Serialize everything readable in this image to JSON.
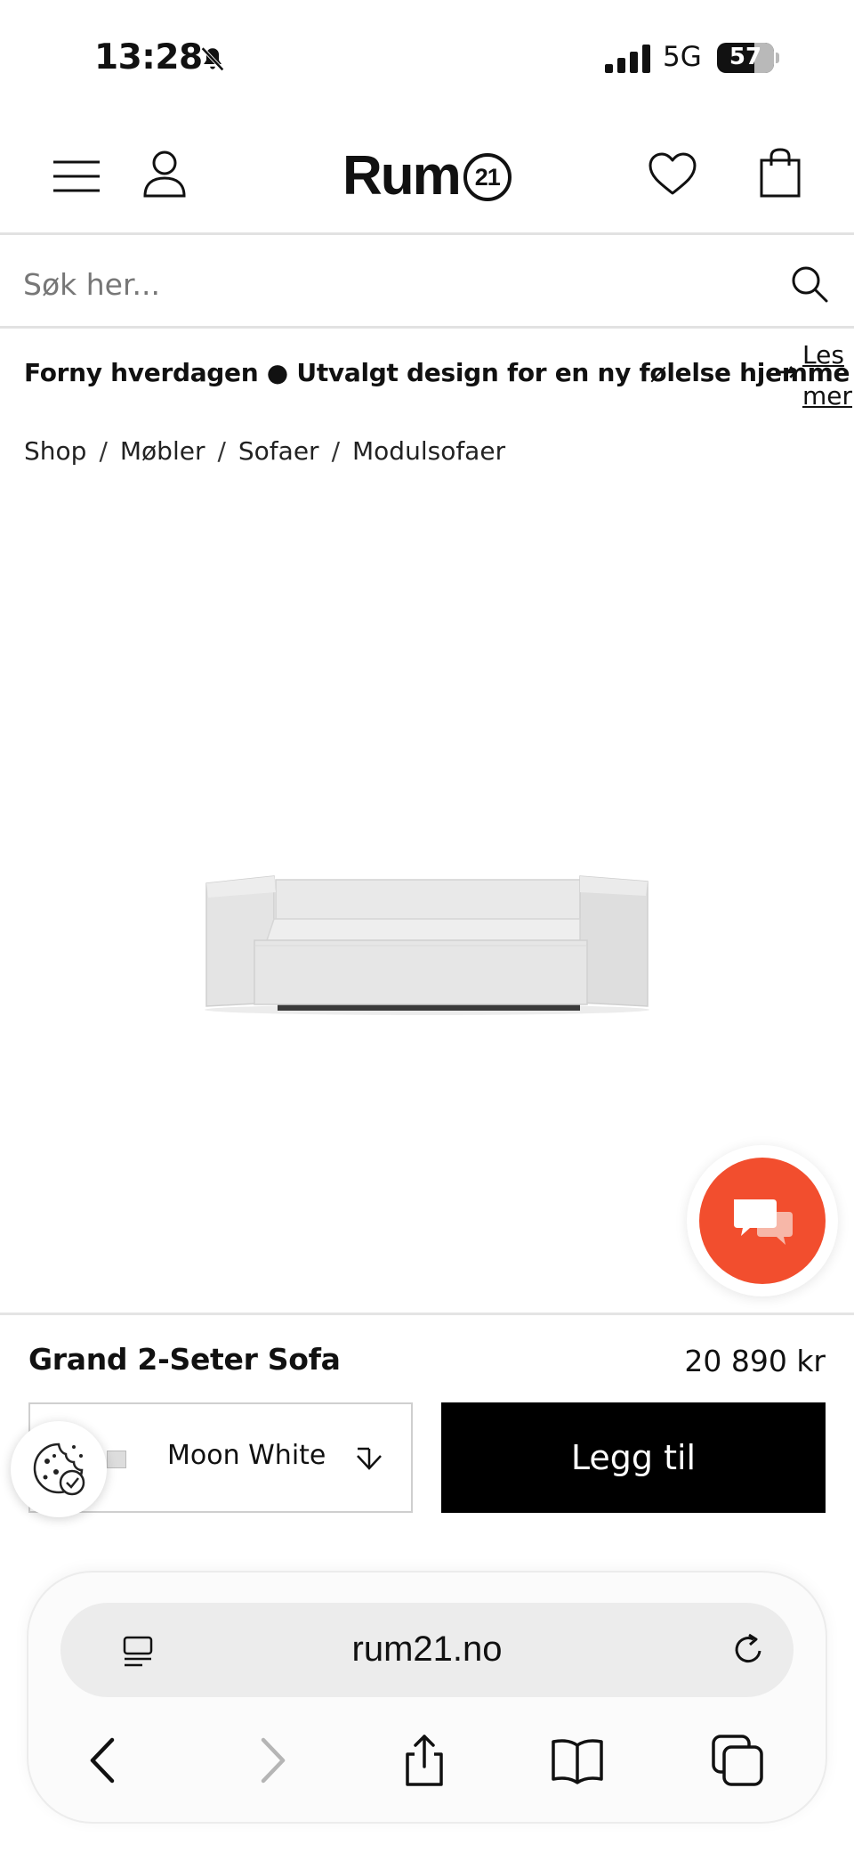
{
  "status_bar": {
    "time": "13:28",
    "network": "5G",
    "battery": "57"
  },
  "header": {
    "logo_text": "Rum",
    "logo_badge": "21",
    "icons": [
      "menu-icon",
      "user-icon",
      "heart-icon",
      "bag-icon"
    ]
  },
  "search": {
    "placeholder": "Søk her..."
  },
  "promo": {
    "text": "Forny hverdagen ● Utvalgt design for en ny følelse hjemme",
    "arrow": "→",
    "link_label": "Les mer"
  },
  "breadcrumb": {
    "items": [
      "Shop",
      "Møbler",
      "Sofaer",
      "Modulsofaer"
    ],
    "separator": "/"
  },
  "product": {
    "name": "Grand 2-Seter Sofa",
    "price": "20 890 kr",
    "variant": "Moon White",
    "add_label": "Legg til"
  },
  "browser": {
    "url": "rum21.no"
  },
  "colors": {
    "chat_accent": "#f24e2e",
    "button_bg": "#000000"
  }
}
